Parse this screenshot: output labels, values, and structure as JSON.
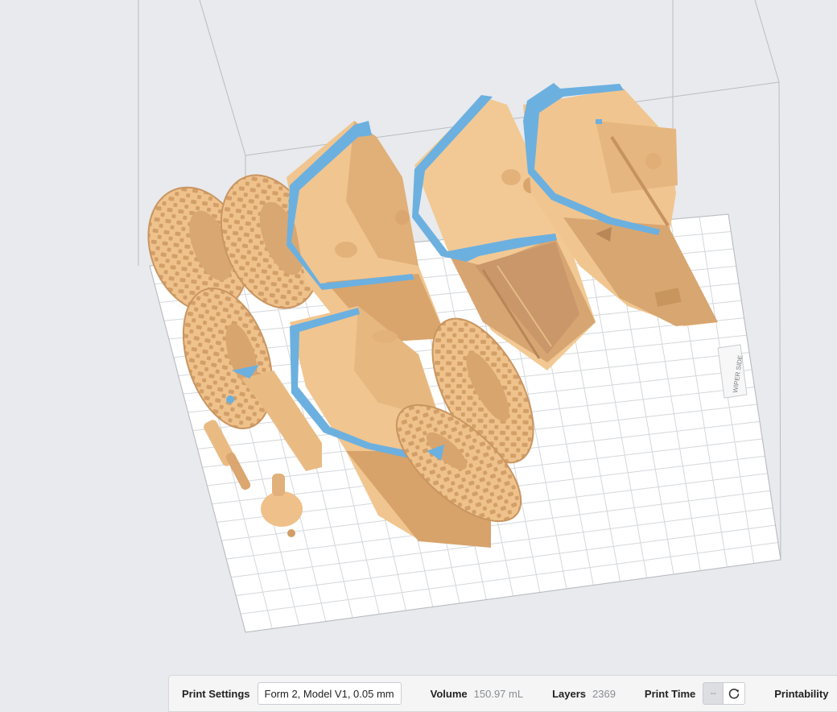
{
  "viewport": {
    "platform_label": "WIPER SIDE",
    "colors": {
      "background": "#e8eaed",
      "platform": "#ffffff",
      "grid_line": "#d4d7db",
      "build_volume_edge": "#b9bcc1",
      "model_resin": "#f2c793",
      "model_shade": "#d7a671",
      "cut_section": "#6cb0e0"
    }
  },
  "status_bar": {
    "print_settings_label": "Print Settings",
    "print_settings_value": "Form 2, Model V1, 0.05 mm",
    "volume_label": "Volume",
    "volume_value": "150.97 mL",
    "layers_label": "Layers",
    "layers_value": "2369",
    "print_time_label": "Print Time",
    "print_time_value": "--",
    "refresh_icon": "refresh-icon",
    "printability_label": "Printability"
  }
}
